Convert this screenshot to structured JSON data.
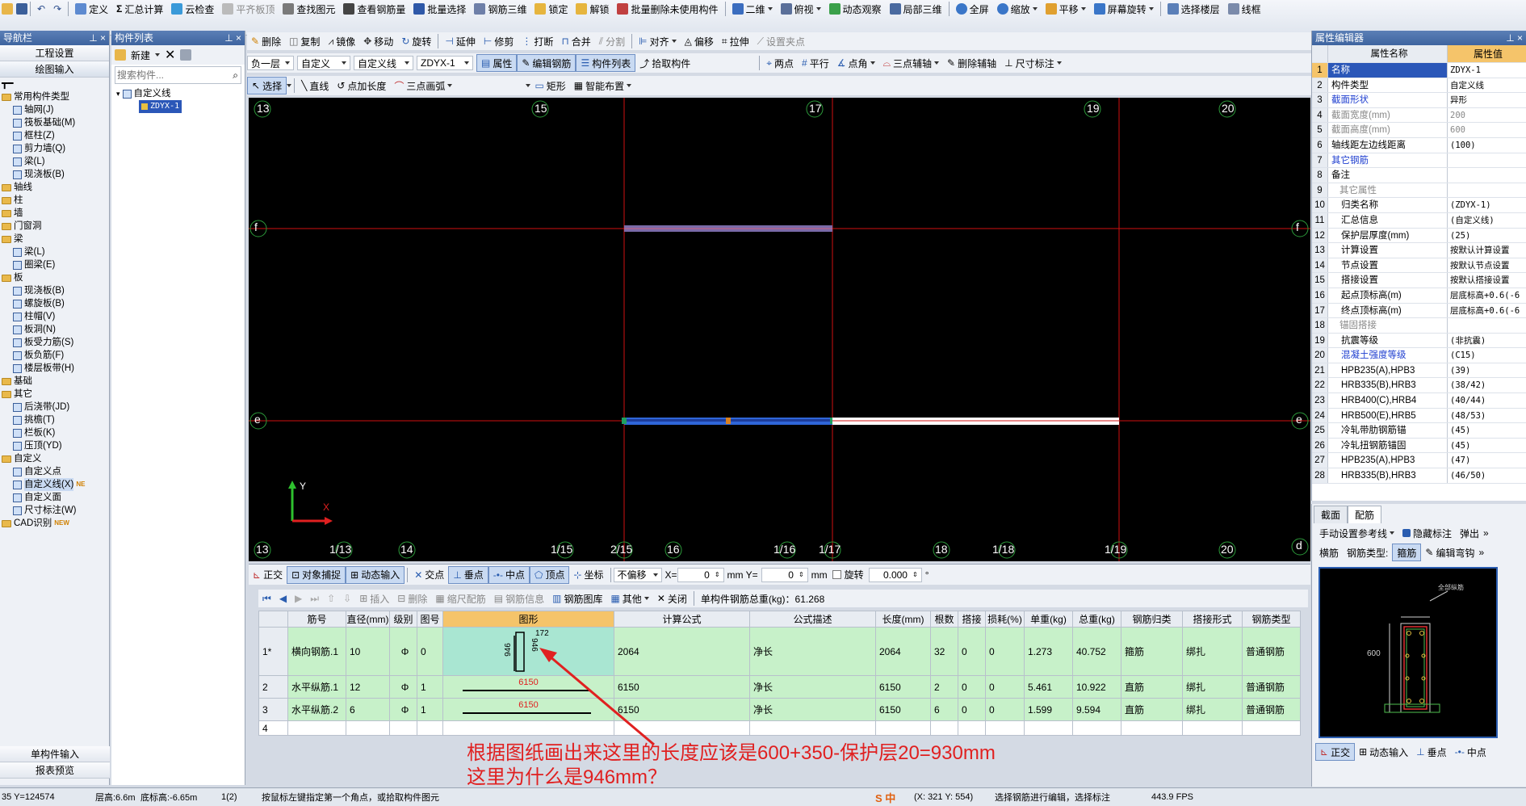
{
  "main_toolbar": {
    "items": [
      "定义",
      "汇总计算",
      "云检查",
      "平齐板顶",
      "查找图元",
      "查看钢筋量",
      "批量选择",
      "钢筋三维",
      "锁定",
      "解锁",
      "批量删除未使用构件",
      "二维",
      "俯视",
      "动态观察",
      "局部三维",
      "全屏",
      "缩放",
      "平移",
      "屏幕旋转",
      "选择楼层",
      "线框"
    ]
  },
  "nav": {
    "title": "导航栏",
    "btn_project": "工程设置",
    "btn_drawing": "绘图输入",
    "tree": [
      {
        "label": "常用构件类型",
        "level": 0,
        "type": "folder"
      },
      {
        "label": "轴网(J)",
        "level": 1,
        "type": "leaf"
      },
      {
        "label": "筏板基础(M)",
        "level": 1,
        "type": "leaf"
      },
      {
        "label": "框柱(Z)",
        "level": 1,
        "type": "leaf"
      },
      {
        "label": "剪力墙(Q)",
        "level": 1,
        "type": "leaf"
      },
      {
        "label": "梁(L)",
        "level": 1,
        "type": "leaf"
      },
      {
        "label": "现浇板(B)",
        "level": 1,
        "type": "leaf"
      },
      {
        "label": "轴线",
        "level": 0,
        "type": "folder"
      },
      {
        "label": "柱",
        "level": 0,
        "type": "folder"
      },
      {
        "label": "墙",
        "level": 0,
        "type": "folder"
      },
      {
        "label": "门窗洞",
        "level": 0,
        "type": "folder"
      },
      {
        "label": "梁",
        "level": 0,
        "type": "folder"
      },
      {
        "label": "梁(L)",
        "level": 1,
        "type": "leaf"
      },
      {
        "label": "圈梁(E)",
        "level": 1,
        "type": "leaf"
      },
      {
        "label": "板",
        "level": 0,
        "type": "folder"
      },
      {
        "label": "现浇板(B)",
        "level": 1,
        "type": "leaf"
      },
      {
        "label": "螺旋板(B)",
        "level": 1,
        "type": "leaf"
      },
      {
        "label": "柱帽(V)",
        "level": 1,
        "type": "leaf"
      },
      {
        "label": "板洞(N)",
        "level": 1,
        "type": "leaf"
      },
      {
        "label": "板受力筋(S)",
        "level": 1,
        "type": "leaf"
      },
      {
        "label": "板负筋(F)",
        "level": 1,
        "type": "leaf"
      },
      {
        "label": "楼层板带(H)",
        "level": 1,
        "type": "leaf"
      },
      {
        "label": "基础",
        "level": 0,
        "type": "folder"
      },
      {
        "label": "其它",
        "level": 0,
        "type": "folder"
      },
      {
        "label": "后浇带(JD)",
        "level": 1,
        "type": "leaf"
      },
      {
        "label": "挑檐(T)",
        "level": 1,
        "type": "leaf"
      },
      {
        "label": "栏板(K)",
        "level": 1,
        "type": "leaf"
      },
      {
        "label": "压顶(YD)",
        "level": 1,
        "type": "leaf"
      },
      {
        "label": "自定义",
        "level": 0,
        "type": "folder"
      },
      {
        "label": "自定义点",
        "level": 1,
        "type": "leaf"
      },
      {
        "label": "自定义线(X)",
        "level": 1,
        "type": "leaf",
        "badge": "NE"
      },
      {
        "label": "自定义面",
        "level": 1,
        "type": "leaf"
      },
      {
        "label": "尺寸标注(W)",
        "level": 1,
        "type": "leaf"
      },
      {
        "label": "CAD识别",
        "level": 0,
        "type": "folder",
        "badge": "NEW"
      }
    ],
    "btn_single": "单构件输入",
    "btn_report": "报表预览"
  },
  "components": {
    "title": "构件列表",
    "new_label": "新建",
    "search_placeholder": "搜索构件...",
    "root": "自定义线",
    "child": "ZDYX-1"
  },
  "toolbar2": [
    "删除",
    "复制",
    "镜像",
    "移动",
    "旋转",
    "延伸",
    "修剪",
    "打断",
    "合并",
    "分割",
    "对齐",
    "偏移",
    "拉伸",
    "设置夹点"
  ],
  "toolbar3": {
    "floor": "负一层",
    "category": "自定义",
    "type": "自定义线",
    "name": "ZDYX-1",
    "btn_props": "属性",
    "btn_edit_rebar": "编辑钢筋",
    "btn_comp_list": "构件列表",
    "btn_pick": "拾取构件",
    "btn_two_points": "两点",
    "btn_parallel": "平行",
    "btn_point_angle": "点角",
    "btn_three_aux": "三点辅轴",
    "btn_del_aux": "删除辅轴",
    "btn_dim": "尺寸标注"
  },
  "toolbar4": {
    "btn_select": "选择",
    "btn_line": "直线",
    "btn_point_len": "点加长度",
    "btn_arc": "三点画弧",
    "btn_rect": "矩形",
    "btn_smart": "智能布置"
  },
  "canvas": {
    "top_labels": [
      "13",
      "15",
      "17",
      "19",
      "20"
    ],
    "bottom_labels": [
      "13",
      "1/13",
      "14",
      "1/15",
      "2/15",
      "16",
      "1/16",
      "1/17",
      "18",
      "1/18",
      "1/19",
      "20"
    ],
    "row_labels": [
      "f",
      "e",
      "d"
    ],
    "axis_y": "Y",
    "axis_x": "X"
  },
  "snap_bar": {
    "ortho": "正交",
    "obj_snap": "对象捕捉",
    "dyn_input": "动态输入",
    "intersect": "交点",
    "perp": "垂点",
    "mid": "中点",
    "vertex": "顶点",
    "coord": "坐标",
    "offset_mode": "不偏移",
    "x_label": "X=",
    "x_val": "0",
    "y_label": "mm Y=",
    "y_val": "0",
    "mm": "mm",
    "rotate": "旋转",
    "rotate_val": "0.000"
  },
  "rebar_toolbar": {
    "insert": "插入",
    "delete": "删除",
    "scale": "缩尺配筋",
    "info": "钢筋信息",
    "lib": "钢筋图库",
    "other": "其他",
    "close": "关闭",
    "total": "单构件钢筋总重(kg)：61.268"
  },
  "rebar_table": {
    "headers": [
      "筋号",
      "直径(mm)",
      "级别",
      "图号",
      "图形",
      "计算公式",
      "公式描述",
      "长度(mm)",
      "根数",
      "搭接",
      "损耗(%)",
      "单重(kg)",
      "总重(kg)",
      "钢筋归类",
      "搭接形式",
      "钢筋类型"
    ],
    "rows": [
      {
        "n": "1*",
        "name": "横向钢筋.1",
        "dia": "10",
        "grade": "Φ",
        "fig": "0",
        "shape_a": "172",
        "shape_b": "946",
        "shape_c": "946",
        "formula": "2064",
        "desc": "净长",
        "len": "2064",
        "count": "32",
        "lap": "0",
        "loss": "0",
        "unit": "1.273",
        "total": "40.752",
        "cat": "箍筋",
        "lapform": "绑扎",
        "rtype": "普通钢筋"
      },
      {
        "n": "2",
        "name": "水平纵筋.1",
        "dia": "12",
        "grade": "Φ",
        "fig": "1",
        "shape_a": "6150",
        "formula": "6150",
        "desc": "净长",
        "len": "6150",
        "count": "2",
        "lap": "0",
        "loss": "0",
        "unit": "5.461",
        "total": "10.922",
        "cat": "直筋",
        "lapform": "绑扎",
        "rtype": "普通钢筋"
      },
      {
        "n": "3",
        "name": "水平纵筋.2",
        "dia": "6",
        "grade": "Φ",
        "fig": "1",
        "shape_a": "6150",
        "formula": "6150",
        "desc": "净长",
        "len": "6150",
        "count": "6",
        "lap": "0",
        "loss": "0",
        "unit": "1.599",
        "total": "9.594",
        "cat": "直筋",
        "lapform": "绑扎",
        "rtype": "普通钢筋"
      },
      {
        "n": "4"
      }
    ]
  },
  "annotation": {
    "line1": "根据图纸画出来这里的长度应该是600+350-保护层20=930mm",
    "line2": "这里为什么是946mm？",
    "color": "#e0202a"
  },
  "props": {
    "title": "属性编辑器",
    "col_name": "属性名称",
    "col_value": "属性值",
    "rows": [
      {
        "n": "1",
        "k": "名称",
        "v": "ZDYX-1",
        "style": "sel"
      },
      {
        "n": "2",
        "k": "构件类型",
        "v": "自定义线"
      },
      {
        "n": "3",
        "k": "截面形状",
        "v": "异形",
        "style": "blue"
      },
      {
        "n": "4",
        "k": "截面宽度(mm)",
        "v": "200",
        "style": "grey"
      },
      {
        "n": "5",
        "k": "截面高度(mm)",
        "v": "600",
        "style": "grey"
      },
      {
        "n": "6",
        "k": "轴线距左边线距离",
        "v": "(100)"
      },
      {
        "n": "7",
        "k": "其它钢筋",
        "v": "",
        "style": "blue"
      },
      {
        "n": "8",
        "k": "备注",
        "v": ""
      },
      {
        "n": "9",
        "k": "其它属性",
        "v": "",
        "style": "grey",
        "group": true
      },
      {
        "n": "10",
        "k": "归类名称",
        "v": "(ZDYX-1)",
        "indent": true
      },
      {
        "n": "11",
        "k": "汇总信息",
        "v": "(自定义线)",
        "indent": true
      },
      {
        "n": "12",
        "k": "保护层厚度(mm)",
        "v": "(25)",
        "indent": true
      },
      {
        "n": "13",
        "k": "计算设置",
        "v": "按默认计算设置",
        "indent": true
      },
      {
        "n": "14",
        "k": "节点设置",
        "v": "按默认节点设置",
        "indent": true
      },
      {
        "n": "15",
        "k": "搭接设置",
        "v": "按默认搭接设置",
        "indent": true
      },
      {
        "n": "16",
        "k": "起点顶标高(m)",
        "v": "层底标高+0.6(-6",
        "indent": true
      },
      {
        "n": "17",
        "k": "终点顶标高(m)",
        "v": "层底标高+0.6(-6",
        "indent": true
      },
      {
        "n": "18",
        "k": "锚固搭接",
        "v": "",
        "style": "grey",
        "group": true
      },
      {
        "n": "19",
        "k": "抗震等级",
        "v": "(非抗震)",
        "indent": true
      },
      {
        "n": "20",
        "k": "混凝土强度等级",
        "v": "(C15)",
        "style": "blue",
        "indent": true
      },
      {
        "n": "21",
        "k": "HPB235(A),HPB3",
        "v": "(39)",
        "indent": true
      },
      {
        "n": "22",
        "k": "HRB335(B),HRB3",
        "v": "(38/42)",
        "indent": true
      },
      {
        "n": "23",
        "k": "HRB400(C),HRB4",
        "v": "(40/44)",
        "indent": true
      },
      {
        "n": "24",
        "k": "HRB500(E),HRB5",
        "v": "(48/53)",
        "indent": true
      },
      {
        "n": "25",
        "k": "冷轧带肋钢筋锚",
        "v": "(45)",
        "indent": true
      },
      {
        "n": "26",
        "k": "冷轧扭钢筋锚固",
        "v": "(45)",
        "indent": true
      },
      {
        "n": "27",
        "k": "HPB235(A),HPB3",
        "v": "(47)",
        "indent": true
      },
      {
        "n": "28",
        "k": "HRB335(B),HRB3",
        "v": "(46/50)",
        "indent": true
      }
    ]
  },
  "section": {
    "tab1": "截面",
    "tab2": "配筋",
    "manual_ref": "手动设置参考线",
    "hide_label": "隐藏标注",
    "popout": "弹出",
    "tab_stirrup": "横筋",
    "rebar_type": "钢筋类型:",
    "stirrup": "箍筋",
    "edit_hook": "编辑弯钩",
    "dim_600": "600",
    "note": "全部纵筋",
    "ortho": "正交",
    "dyn": "动态输入",
    "perp": "垂点",
    "mid": "中点"
  },
  "status": {
    "coords": "35 Y=124574",
    "floor_h": "层高:6.6m",
    "floor_b": "底标高:-6.65m",
    "sel": "1(2)",
    "hint": "按鼠标左键指定第一个角点，或拾取构件图元",
    "sec_coords": "(X: 321 Y: 554)",
    "sec_hint": "选择钢筋进行编辑，选择标注",
    "fps": "443.9 FPS"
  }
}
